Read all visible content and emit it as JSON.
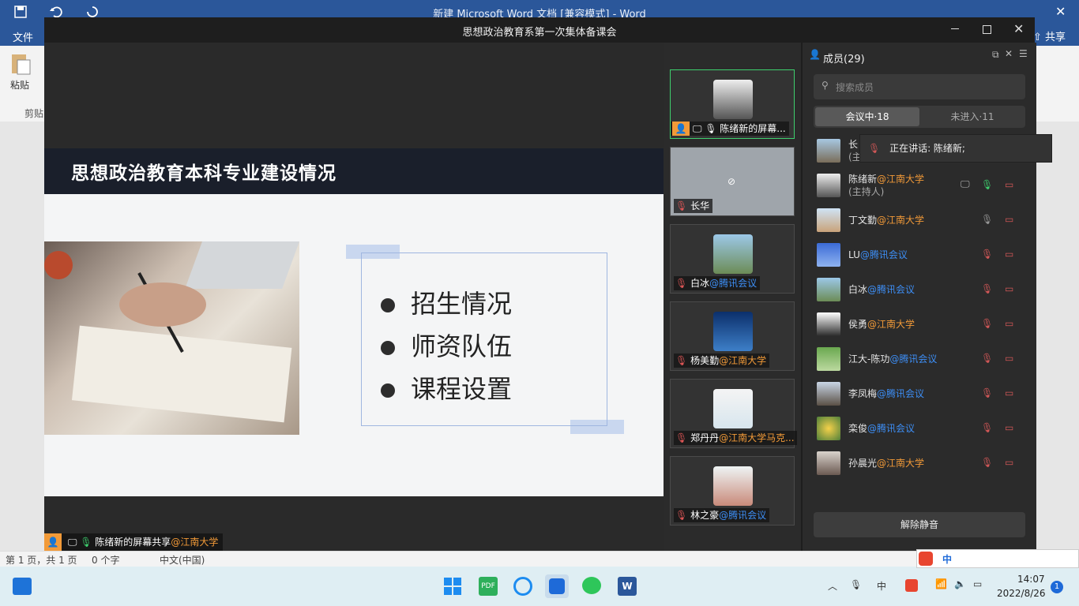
{
  "word": {
    "title": "新建 Microsoft Word 文档 [兼容模式] - Word",
    "file_tab": "文件",
    "share": "共享",
    "paste": "粘贴",
    "clipboard": "剪贴",
    "status_page": "第 1 页，共 1 页",
    "status_words": "0 个字",
    "status_lang": "中文(中国)"
  },
  "meeting": {
    "title": "思想政治教育系第一次集体备课会",
    "share_caption_name": "陈绪新的屏幕共享",
    "share_caption_org": "@江南大学"
  },
  "slide": {
    "title": "思想政治教育本科专业建设情况",
    "bullets": [
      "招生情况",
      "师资队伍",
      "课程设置"
    ]
  },
  "video_tiles": [
    {
      "name": "陈绪新的屏幕...",
      "org": ""
    },
    {
      "name": "长华",
      "org": ""
    },
    {
      "name": "白冰",
      "org": "@腾讯会议"
    },
    {
      "name": "杨美勤",
      "org": "@江南大学"
    },
    {
      "name": "郑丹丹",
      "org": "@江南大学马克..."
    },
    {
      "name": "林之豪",
      "org": "@腾讯会议"
    }
  ],
  "members": {
    "header": "成员(29)",
    "search_placeholder": "搜索成员",
    "tab_in": "会议中·18",
    "tab_out": "未进入·11",
    "speaking_tip": "正在讲话: 陈绪新;",
    "unmute_btn": "解除静音",
    "list": [
      {
        "name": "长",
        "org": "",
        "sub": "(主"
      },
      {
        "name": "陈绪新",
        "org": "@江南大学",
        "sub": "(主持人)"
      },
      {
        "name": "丁文勤",
        "org": "@江南大学",
        "sub": ""
      },
      {
        "name": "LU",
        "org": "@腾讯会议",
        "sub": ""
      },
      {
        "name": "白冰",
        "org": "@腾讯会议",
        "sub": ""
      },
      {
        "name": "侯勇",
        "org": "@江南大学",
        "sub": ""
      },
      {
        "name": "江大-陈功",
        "org": "@腾讯会议",
        "sub": ""
      },
      {
        "name": "李凤梅",
        "org": "@腾讯会议",
        "sub": ""
      },
      {
        "name": "栾俊",
        "org": "@腾讯会议",
        "sub": ""
      },
      {
        "name": "孙晨光",
        "org": "@江南大学",
        "sub": ""
      }
    ]
  },
  "taskbar": {
    "time": "14:07",
    "date": "2022/8/26",
    "ime": "中",
    "notif": "1"
  },
  "colors": {
    "word_blue": "#2b579a",
    "accent_orange": "#f29a38",
    "accent_blue": "#3d8ef5",
    "active_green": "#3ecf6e"
  }
}
